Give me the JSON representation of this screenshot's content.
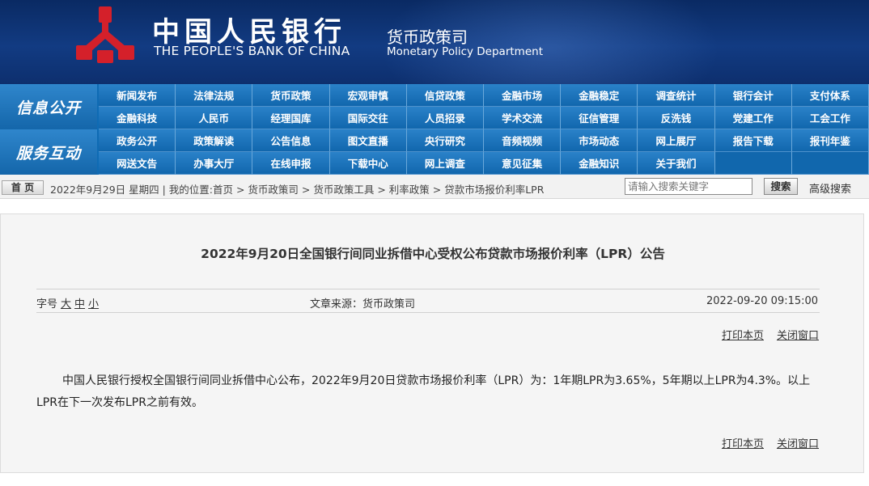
{
  "header": {
    "bank_name_cn": "中国人民银行",
    "bank_name_en": "THE PEOPLE'S BANK OF CHINA",
    "dept_cn": "货币政策司",
    "dept_en": "Monetary Policy Department",
    "logo_icon": "pboc-logo-icon",
    "colors": {
      "banner": "#0d2f6e",
      "logo_red": "#d4202a",
      "nav": "#1167ad"
    }
  },
  "nav": {
    "side_labels": [
      "信息公开",
      "服务互动"
    ],
    "rows": [
      [
        "新闻发布",
        "法律法规",
        "货币政策",
        "宏观审慎",
        "信贷政策",
        "金融市场",
        "金融稳定",
        "调查统计",
        "银行会计",
        "支付体系"
      ],
      [
        "金融科技",
        "人民币",
        "经理国库",
        "国际交往",
        "人员招录",
        "学术交流",
        "征信管理",
        "反洗钱",
        "党建工作",
        "工会工作"
      ],
      [
        "政务公开",
        "政策解读",
        "公告信息",
        "图文直播",
        "央行研究",
        "音频视频",
        "市场动态",
        "网上展厅",
        "报告下载",
        "报刊年鉴"
      ],
      [
        "网送文告",
        "办事大厅",
        "在线申报",
        "下载中心",
        "网上调查",
        "意见征集",
        "金融知识",
        "关于我们",
        "",
        ""
      ]
    ]
  },
  "breadcrumb": {
    "home": "首 页",
    "text": "2022年9月29日 星期四 | 我的位置:首页 > 货币政策司 > 货币政策工具 > 利率政策 > 贷款市场报价利率LPR",
    "search_placeholder": "请输入搜索关键字",
    "search_button": "搜索",
    "advanced_search": "高级搜索"
  },
  "article": {
    "title": "2022年9月20日全国银行间同业拆借中心受权公布贷款市场报价利率（LPR）公告",
    "font_size_label": "字号",
    "font_size_options": [
      "大",
      "中",
      "小"
    ],
    "source": "文章来源：货币政策司",
    "date": "2022-09-20 09:15:00",
    "print": "打印本页",
    "close": "关闭窗口",
    "body": "中国人民银行授权全国银行间同业拆借中心公布，2022年9月20日贷款市场报价利率（LPR）为：1年期LPR为3.65%，5年期以上LPR为4.3%。以上LPR在下一次发布LPR之前有效。"
  }
}
